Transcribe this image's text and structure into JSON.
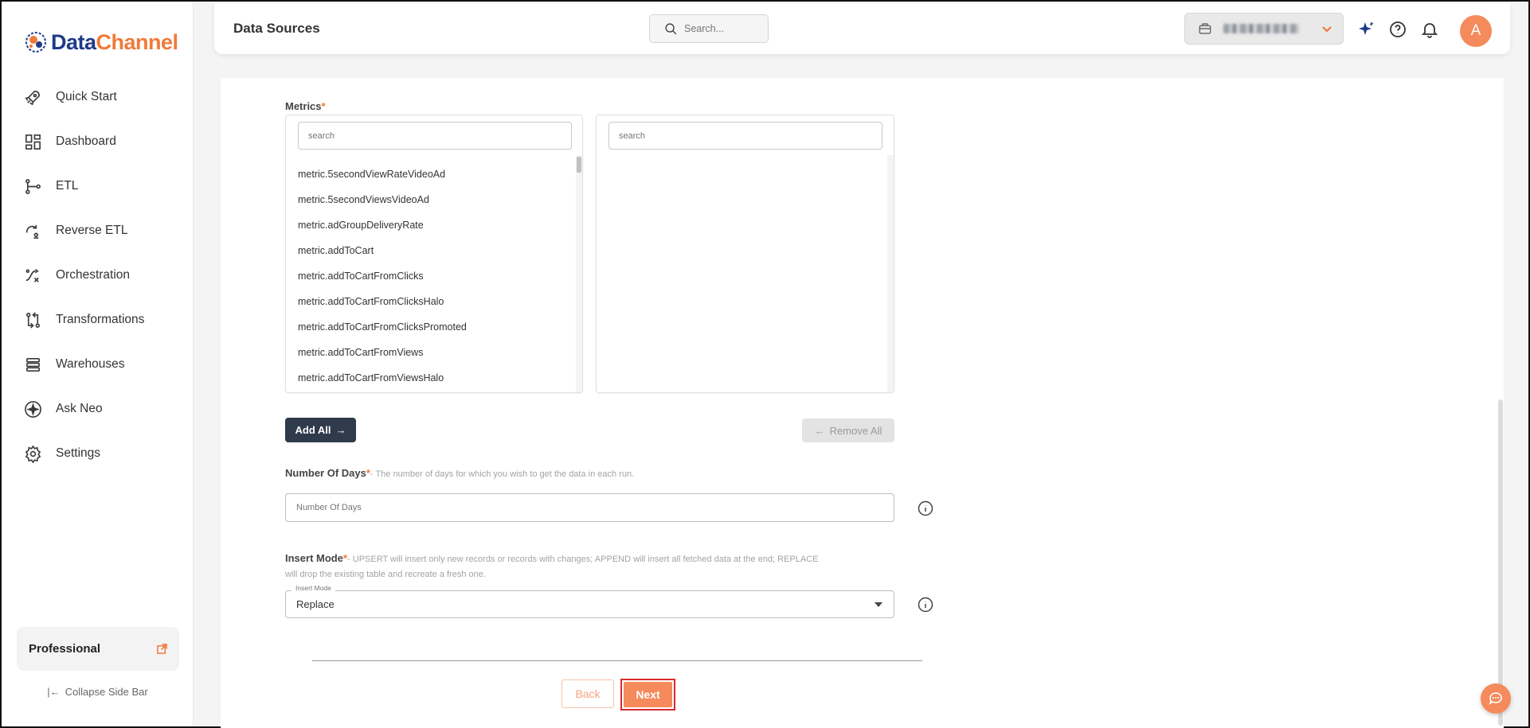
{
  "brand": {
    "name_part1": "Data",
    "name_part2": "Channel",
    "accent_color": "#f07a3a",
    "primary_color": "#1e3a8a"
  },
  "sidebar": {
    "items": [
      {
        "label": "Quick Start",
        "icon": "rocket-icon"
      },
      {
        "label": "Dashboard",
        "icon": "dashboard-icon"
      },
      {
        "label": "ETL",
        "icon": "etl-icon"
      },
      {
        "label": "Reverse ETL",
        "icon": "reverse-etl-icon"
      },
      {
        "label": "Orchestration",
        "icon": "orchestration-icon"
      },
      {
        "label": "Transformations",
        "icon": "transformations-icon"
      },
      {
        "label": "Warehouses",
        "icon": "warehouses-icon"
      },
      {
        "label": "Ask Neo",
        "icon": "sparkle-icon"
      },
      {
        "label": "Settings",
        "icon": "gear-icon"
      }
    ],
    "plan_label": "Professional",
    "collapse_label": "Collapse Side Bar"
  },
  "header": {
    "title": "Data Sources",
    "search_placeholder": "Search...",
    "avatar_initial": "A"
  },
  "metrics": {
    "label": "Metrics",
    "required_mark": "*",
    "available_search_placeholder": "search",
    "selected_search_placeholder": "search",
    "available_items": [
      "metric.5secondViewRateVideoAd",
      "metric.5secondViewsVideoAd",
      "metric.adGroupDeliveryRate",
      "metric.addToCart",
      "metric.addToCartFromClicks",
      "metric.addToCartFromClicksHalo",
      "metric.addToCartFromClicksPromoted",
      "metric.addToCartFromViews",
      "metric.addToCartFromViewsHalo"
    ],
    "add_all_label": "Add All",
    "remove_all_label": "Remove All"
  },
  "number_of_days": {
    "label": "Number Of Days",
    "required_mark": "*",
    "hint": "- The number of days for which you wish to get the data in each run.",
    "placeholder": "Number Of Days"
  },
  "insert_mode": {
    "label": "Insert Mode",
    "required_mark": "*",
    "hint_line1": "- UPSERT will insert only new records or records with changes; APPEND will insert all fetched data at the end; REPLACE",
    "hint_line2": "will drop the existing table and recreate a fresh one.",
    "legend": "Insert Mode",
    "value": "Replace"
  },
  "footer": {
    "back_label": "Back",
    "next_label": "Next"
  }
}
